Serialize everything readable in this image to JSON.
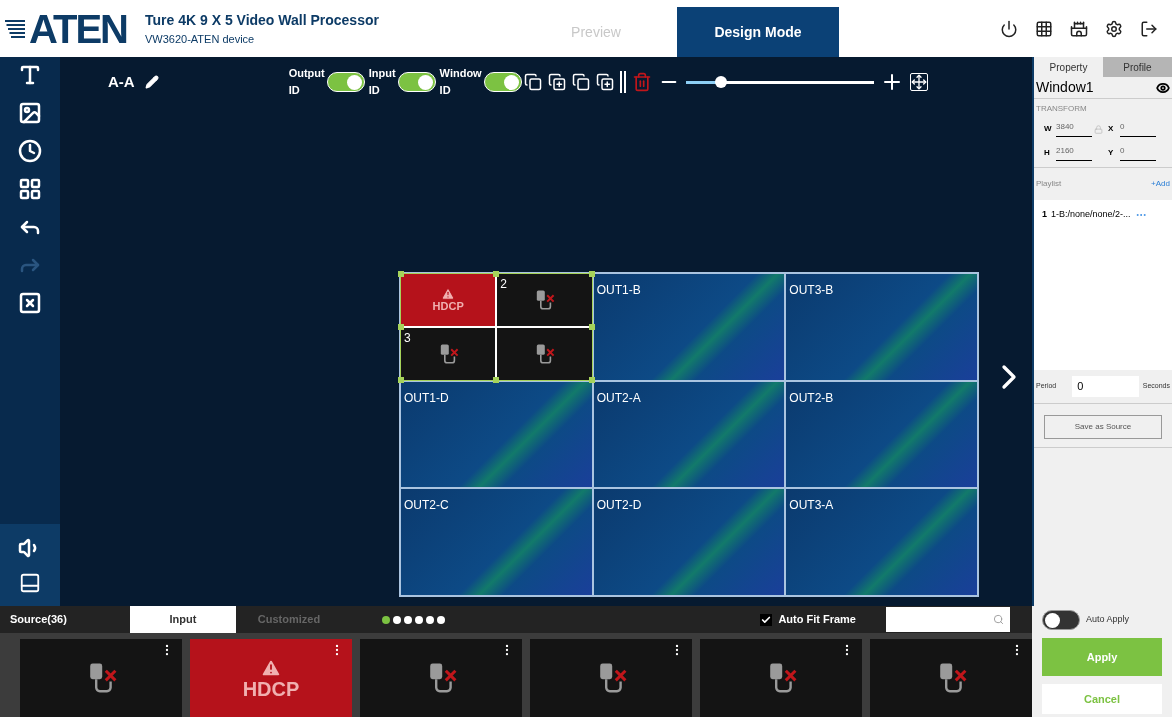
{
  "header": {
    "logo": "ATEN",
    "title": "Ture 4K 9 X 5 Video Wall Processor",
    "subtitle": "VW3620-ATEN device"
  },
  "mode_tabs": [
    {
      "label": "Preview",
      "selected": false
    },
    {
      "label": "Design Mode",
      "selected": true
    }
  ],
  "sidebar_tools": [
    {
      "kind": "add_text",
      "disabled": false
    },
    {
      "kind": "add_image",
      "disabled": false
    },
    {
      "kind": "add_clock",
      "disabled": false
    },
    {
      "kind": "add_layout",
      "disabled": false
    },
    {
      "kind": "undo",
      "disabled": false
    },
    {
      "kind": "redo",
      "disabled": true
    },
    {
      "kind": "close_windows",
      "disabled": false
    }
  ],
  "toolbar": {
    "layout_name": "A-A",
    "toggles": [
      {
        "label": "Output ID",
        "on": true
      },
      {
        "label": "Input ID",
        "on": true
      },
      {
        "label": "Window ID",
        "on": true
      }
    ],
    "zoom": {
      "level": 0.19
    }
  },
  "wall": {
    "window": [
      {
        "kind": "hdcp",
        "label": "HDCP"
      },
      {
        "kind": "no_signal",
        "id": "2"
      },
      {
        "kind": "no_signal",
        "id": "3"
      },
      {
        "kind": "no_signal"
      }
    ],
    "outputs": [
      "OUT1-B",
      "OUT3-B",
      "OUT1-D",
      "OUT2-A",
      "OUT2-B",
      "OUT2-C",
      "OUT2-D",
      "OUT3-A"
    ]
  },
  "property_panel": {
    "tabs": [
      {
        "label": "Property",
        "selected": true
      },
      {
        "label": "Profile",
        "selected": false
      }
    ],
    "window_name": "Window1",
    "section": "TRANSFORM",
    "fields": [
      {
        "label": "W",
        "value": "3840"
      },
      {
        "label": "X",
        "value": "0"
      },
      {
        "label": "H",
        "value": "2160"
      },
      {
        "label": "Y",
        "value": "0"
      }
    ],
    "playlist_label": "Playlist",
    "add_link": "+Add",
    "playlist": [
      {
        "index": "1",
        "name": "1-B:/none/none/2-..."
      }
    ],
    "period_label": "Period",
    "period_value": "0",
    "period_unit": "Seconds",
    "save_button": "Save as Source"
  },
  "source_bar": {
    "title": "Source(36)",
    "tabs": [
      {
        "label": "Input",
        "selected": true
      },
      {
        "label": "Customized",
        "selected": false
      }
    ],
    "pages": [
      {
        "selected": true
      },
      {
        "selected": false
      },
      {
        "selected": false
      },
      {
        "selected": false
      },
      {
        "selected": false
      },
      {
        "selected": false
      }
    ],
    "auto_fit": {
      "label": "Auto Fit Frame",
      "checked": true
    },
    "thumbnails": [
      {
        "kind": "no_signal"
      },
      {
        "kind": "hdcp",
        "label": "HDCP"
      },
      {
        "kind": "no_signal"
      },
      {
        "kind": "no_signal"
      },
      {
        "kind": "no_signal"
      },
      {
        "kind": "no_signal"
      }
    ]
  },
  "apply_panel": {
    "auto_apply": {
      "label": "Auto Apply",
      "on": false
    },
    "apply": "Apply",
    "cancel": "Cancel"
  }
}
